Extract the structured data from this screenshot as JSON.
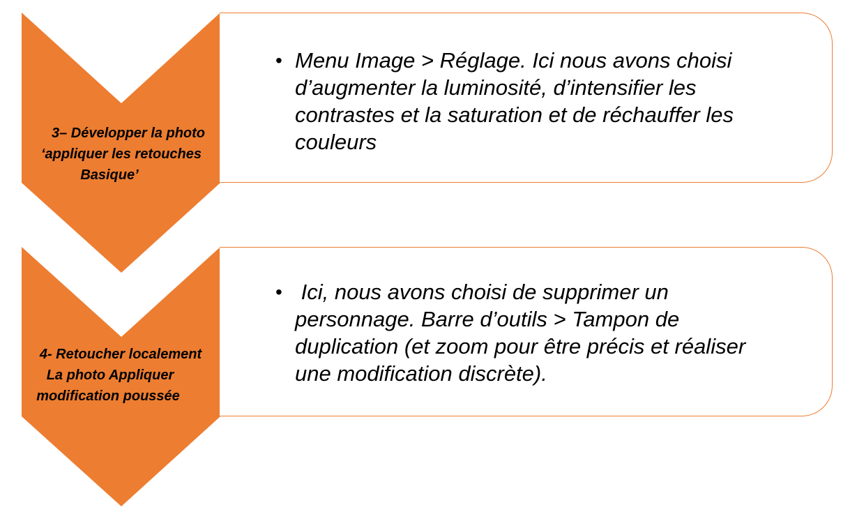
{
  "colors": {
    "chevron_fill": "#ED7D31",
    "card_border": "#ED7D31",
    "card_fill": "#FFFFFF",
    "text": "#000000"
  },
  "steps": [
    {
      "label_lines": [
        "3– Développer la photo",
        "‘appliquer les retouches",
        "Basique’"
      ],
      "bullet_lines": [
        "Menu Image > Réglage. Ici nous avons choisi",
        "d’augmenter la luminosité, d’intensifier les",
        "contrastes et la saturation et de réchauffer les",
        "couleurs"
      ]
    },
    {
      "label_lines": [
        "4- Retoucher localement",
        "La photo Appliquer",
        "modification poussée"
      ],
      "bullet_lines": [
        " Ici, nous avons choisi de supprimer un",
        "personnage. Barre d’outils > Tampon de",
        "duplication (et zoom pour être précis et réaliser",
        "une modification discrète)."
      ]
    }
  ]
}
